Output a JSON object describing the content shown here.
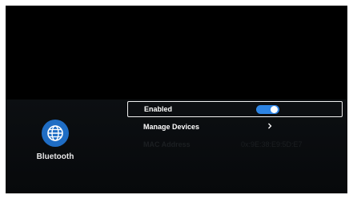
{
  "section": {
    "title": "Bluetooth",
    "icon": "globe-icon",
    "icon_color": "#1f6dc4"
  },
  "rows": [
    {
      "label": "Enabled",
      "value_type": "toggle",
      "toggle_on": true,
      "toggle_color": "#2d84e4"
    },
    {
      "label": "Manage Devices",
      "value_type": "chevron",
      "icon": "chevron-right-icon"
    },
    {
      "label": "MAC Address",
      "value": "0x:9E:38:E9:5D:E7"
    }
  ]
}
